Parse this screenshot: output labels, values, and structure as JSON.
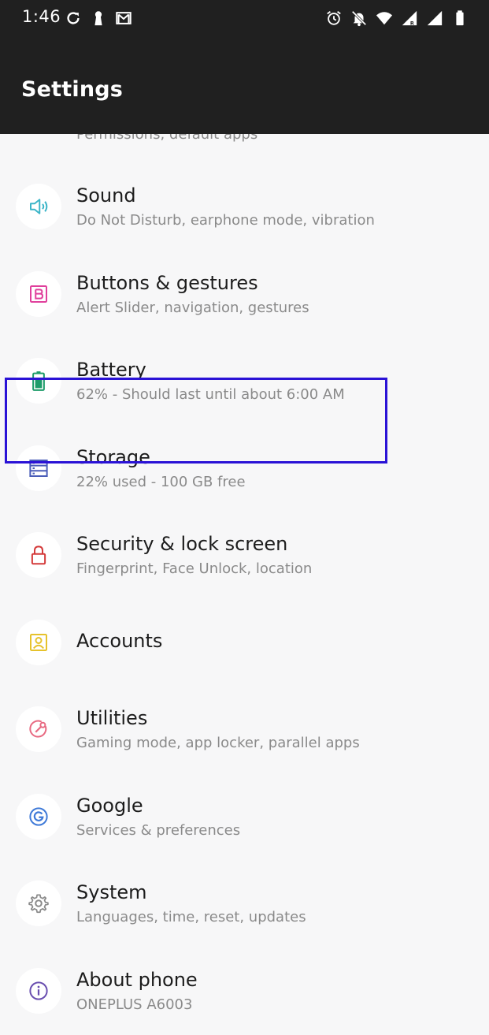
{
  "status_bar": {
    "time": "1:46",
    "left_icons": [
      "sync-icon",
      "keyhole-icon",
      "gmail-icon"
    ],
    "right_icons": [
      "alarm-icon",
      "notifications-off-icon",
      "wifi-icon",
      "signal-roaming-icon",
      "signal-icon",
      "battery-icon"
    ]
  },
  "app_bar": {
    "title": "Settings"
  },
  "settings_list": {
    "clipped_item": {
      "subtitle": "Permissions, default apps"
    },
    "items": [
      {
        "title": "Sound",
        "subtitle": "Do Not Disturb, earphone mode, vibration",
        "icon": "sound-icon",
        "color": "#3bb5c8"
      },
      {
        "title": "Buttons & gestures",
        "subtitle": "Alert Slider, navigation, gestures",
        "icon": "buttons-icon",
        "color": "#e0409c"
      },
      {
        "title": "Battery",
        "subtitle": "62% - Should last until about 6:00 AM",
        "icon": "battery-icon",
        "color": "#1e9c6a"
      },
      {
        "title": "Storage",
        "subtitle": "22% used - 100 GB free",
        "icon": "storage-icon",
        "color": "#4a5db8"
      },
      {
        "title": "Security & lock screen",
        "subtitle": "Fingerprint, Face Unlock, location",
        "icon": "lock-icon",
        "color": "#d43a3a"
      },
      {
        "title": "Accounts",
        "subtitle": "",
        "icon": "accounts-icon",
        "color": "#e6c22c"
      },
      {
        "title": "Utilities",
        "subtitle": "Gaming mode, app locker, parallel apps",
        "icon": "utilities-icon",
        "color": "#e86a82"
      },
      {
        "title": "Google",
        "subtitle": "Services & preferences",
        "icon": "google-icon",
        "color": "#3f7ad8"
      },
      {
        "title": "System",
        "subtitle": "Languages, time, reset, updates",
        "icon": "gear-icon",
        "color": "#8a8a8a"
      },
      {
        "title": "About phone",
        "subtitle": "ONEPLUS A6003",
        "icon": "info-icon",
        "color": "#6a4fb0"
      }
    ]
  },
  "highlight_color": "#2a12d6"
}
